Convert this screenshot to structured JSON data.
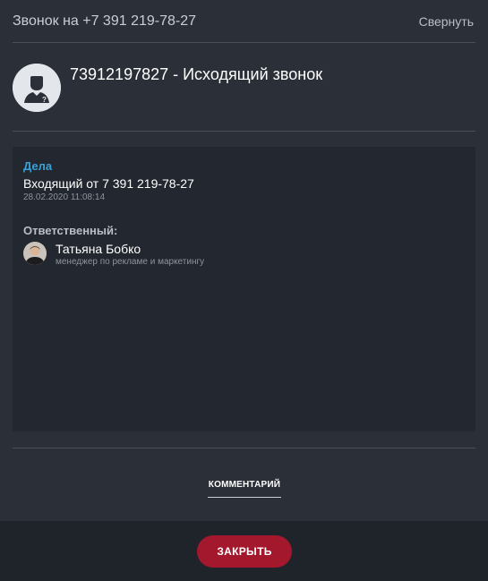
{
  "header": {
    "title": "Звонок на +7 391 219-78-27",
    "collapse_label": "Свернуть"
  },
  "call": {
    "title": "73912197827 - Исходящий звонок",
    "avatar_icon": "unknown-contact-icon"
  },
  "tasks": {
    "heading": "Дела",
    "item_title": "Входящий от 7 391 219-78-27",
    "item_date": "28.02.2020 11:08:14"
  },
  "responsible": {
    "label": "Ответственный:",
    "name": "Татьяна Бобко",
    "role": "менеджер по рекламе и маркетингу"
  },
  "tabs": {
    "comment_label": "КОММЕНТАРИЙ"
  },
  "footer": {
    "close_label": "ЗАКРЫТЬ"
  },
  "colors": {
    "background": "#2b3038",
    "panel": "#232830",
    "accent_link": "#3aa0d8",
    "close_button": "#a3182c"
  }
}
